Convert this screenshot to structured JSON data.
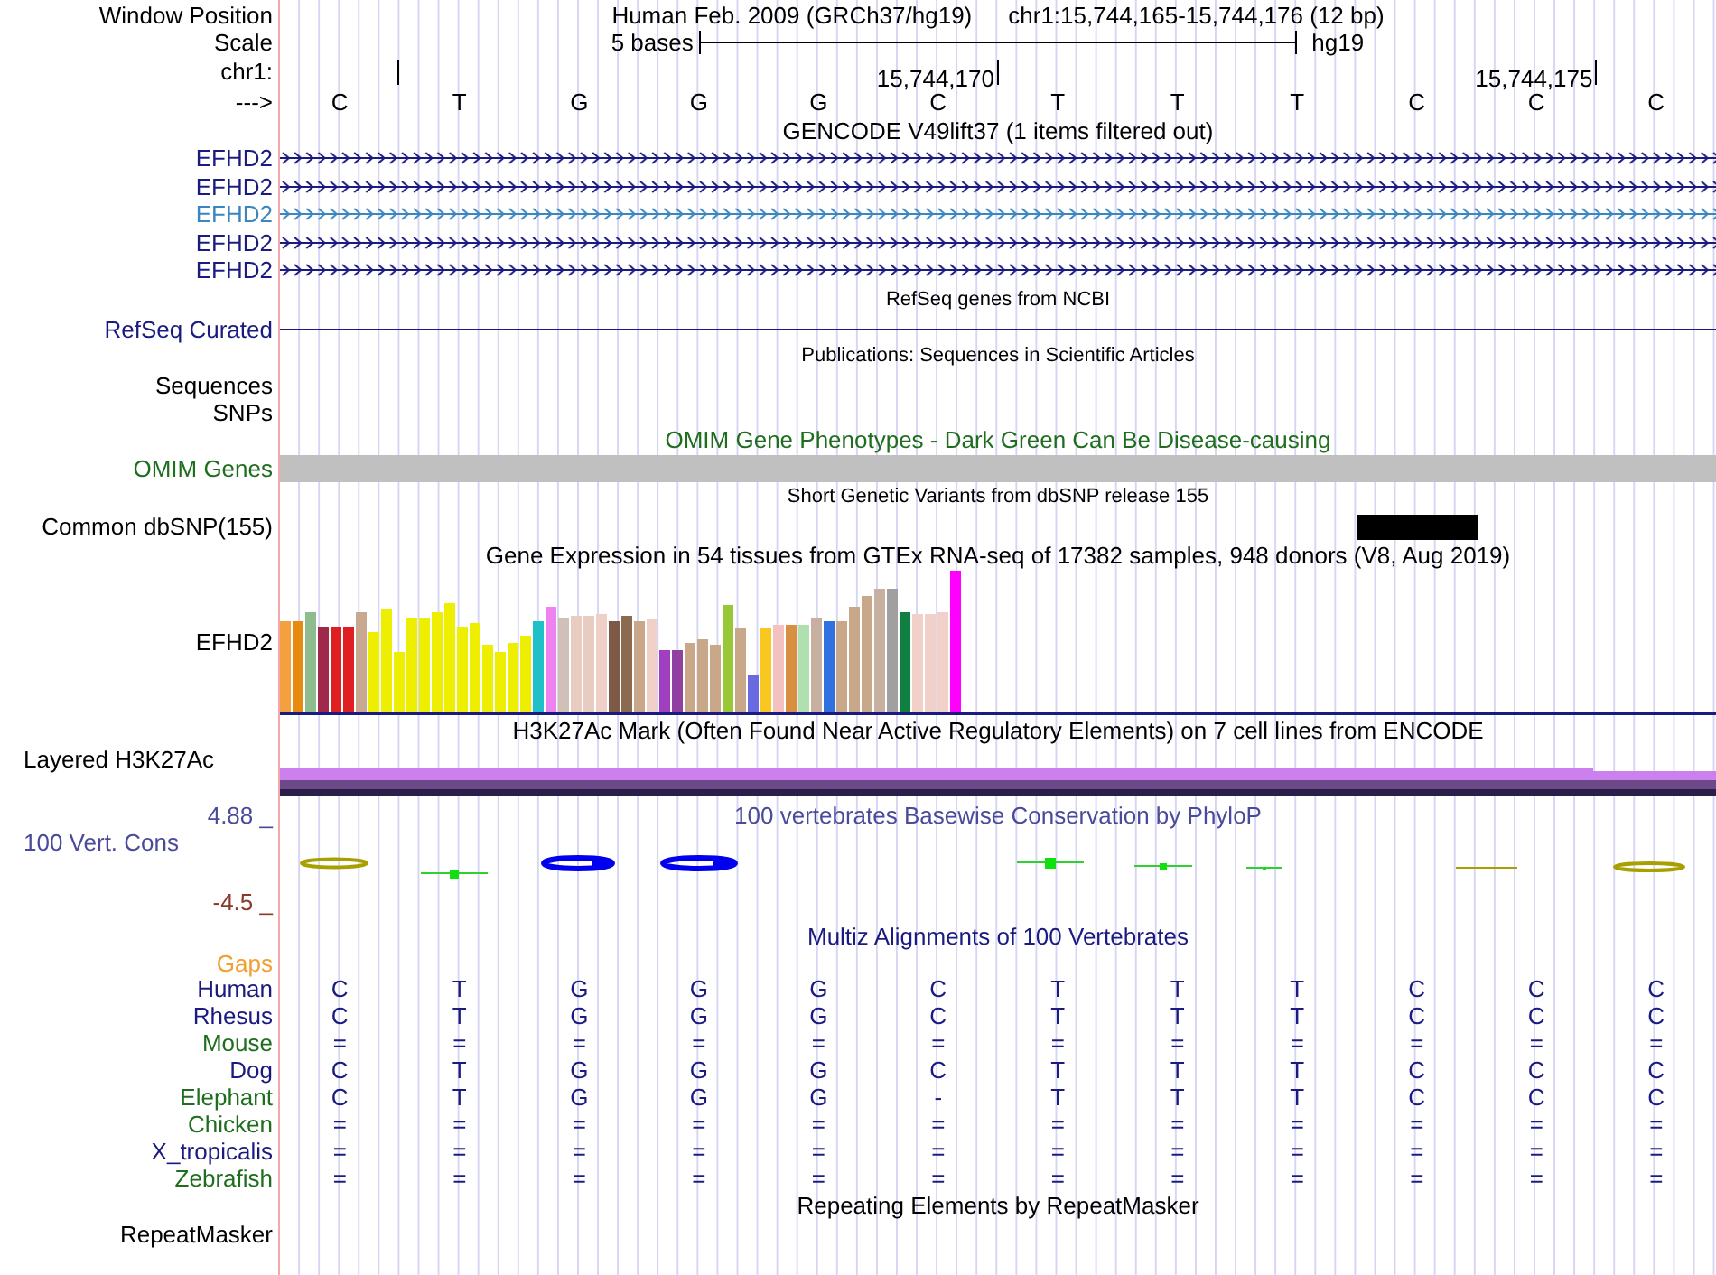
{
  "header": {
    "label": "Window Position",
    "assembly": "Human Feb. 2009 (GRCh37/hg19)",
    "position": "chr1:15,744,165-15,744,176 (12 bp)"
  },
  "scale": {
    "label": "Scale",
    "span": "5 bases",
    "assembly": "hg19"
  },
  "coordinates": {
    "label": "chr1:",
    "ticks": [
      "15,744,170",
      "15,744,175"
    ]
  },
  "bases": {
    "label": "--->",
    "letters": [
      "C",
      "T",
      "G",
      "G",
      "G",
      "C",
      "T",
      "T",
      "T",
      "C",
      "C",
      "C"
    ]
  },
  "tracks": [
    {
      "kind": "gene",
      "title": "GENCODE V49lift37 (1 items filtered out)",
      "items": [
        {
          "label": "EFHD2",
          "color": "#1a1a80"
        },
        {
          "label": "EFHD2",
          "color": "#1a1a80"
        },
        {
          "label": "EFHD2",
          "color": "#3a86c0"
        },
        {
          "label": "EFHD2",
          "color": "#1a1a80"
        },
        {
          "label": "EFHD2",
          "color": "#1a1a80"
        }
      ]
    },
    {
      "kind": "refseq",
      "title": "RefSeq genes from NCBI",
      "label": "RefSeq Curated"
    },
    {
      "kind": "labels",
      "title": "Publications: Sequences in Scientific Articles",
      "labels": [
        "Sequences",
        "SNPs"
      ]
    },
    {
      "kind": "omim",
      "title": "OMIM Gene Phenotypes - Dark Green Can Be Disease-causing",
      "label": "OMIM Genes"
    },
    {
      "kind": "snp",
      "title": "Short Genetic Variants from dbSNP release 155",
      "label": "Common dbSNP(155)"
    },
    {
      "kind": "gtex",
      "title": "Gene Expression in 54 tissues from GTEx RNA-seq of 17382 samples, 948 donors (V8, Aug 2019)",
      "label": "EFHD2"
    },
    {
      "kind": "h3k27ac",
      "title": "H3K27Ac Mark (Often Found Near Active Regulatory Elements) on 7 cell lines from ENCODE",
      "label": "Layered H3K27Ac"
    },
    {
      "kind": "phylop",
      "title": "100 vertebrates Basewise Conservation by PhyloP",
      "label": "100 Vert. Cons",
      "max": "4.88 _",
      "min": "-4.5 _"
    },
    {
      "kind": "multiz",
      "title": "Multiz Alignments of 100 Vertebrates",
      "gaps_label": "Gaps",
      "species": [
        {
          "name": "Human",
          "color": "#1a1a80",
          "bases": [
            "C",
            "T",
            "G",
            "G",
            "G",
            "C",
            "T",
            "T",
            "T",
            "C",
            "C",
            "C"
          ]
        },
        {
          "name": "Rhesus",
          "color": "#1a1a80",
          "bases": [
            "C",
            "T",
            "G",
            "G",
            "G",
            "C",
            "T",
            "T",
            "T",
            "C",
            "C",
            "C"
          ]
        },
        {
          "name": "Mouse",
          "color": "#1e6e1e",
          "bases": [
            "=",
            "=",
            "=",
            "=",
            "=",
            "=",
            "=",
            "=",
            "=",
            "=",
            "=",
            "="
          ]
        },
        {
          "name": "Dog",
          "color": "#1a1a80",
          "bases": [
            "C",
            "T",
            "G",
            "G",
            "G",
            "C",
            "T",
            "T",
            "T",
            "C",
            "C",
            "C"
          ]
        },
        {
          "name": "Elephant",
          "color": "#1e6e1e",
          "bases": [
            "C",
            "T",
            "G",
            "G",
            "G",
            "-",
            "T",
            "T",
            "T",
            "C",
            "C",
            "C"
          ]
        },
        {
          "name": "Chicken",
          "color": "#1e6e1e",
          "bases": [
            "=",
            "=",
            "=",
            "=",
            "=",
            "=",
            "=",
            "=",
            "=",
            "=",
            "=",
            "="
          ]
        },
        {
          "name": "X_tropicalis",
          "color": "#1a1a80",
          "bases": [
            "=",
            "=",
            "=",
            "=",
            "=",
            "=",
            "=",
            "=",
            "=",
            "=",
            "=",
            "="
          ]
        },
        {
          "name": "Zebrafish",
          "color": "#1e6e1e",
          "bases": [
            "=",
            "=",
            "=",
            "=",
            "=",
            "=",
            "=",
            "=",
            "=",
            "=",
            "=",
            "="
          ]
        }
      ]
    },
    {
      "kind": "repeat",
      "title": "Repeating Elements by RepeatMasker",
      "label": "RepeatMasker"
    }
  ]
}
